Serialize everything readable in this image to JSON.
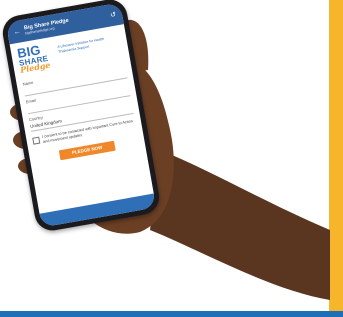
{
  "browser": {
    "title": "Big Share Pledge",
    "url": "bigsharepledge.org",
    "back_icon": "back-arrow-icon",
    "share_icon": "share-icon"
  },
  "logo": {
    "big": "BIG",
    "share": "SHARE",
    "pledge": "Pledge"
  },
  "tagline": "A Lifesaver Initiative for Health Thalesemia Support",
  "form": {
    "name_label": "Name",
    "email_label": "Email",
    "country_label": "Country",
    "country_value": "United Kingdom",
    "consent_text": "I consent to be contacted with important Cure to Action and movement updates",
    "submit_label": "PLEDGE NOW"
  },
  "colors": {
    "accent_orange": "#f0882a",
    "brand_blue": "#2f6fb7",
    "side_yellow": "#f7b52b"
  }
}
